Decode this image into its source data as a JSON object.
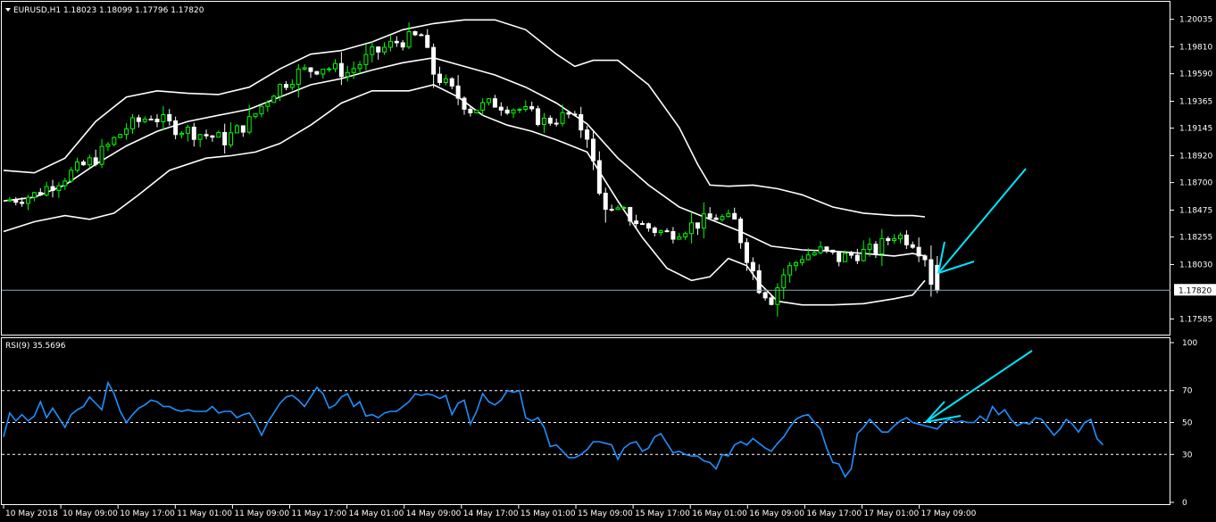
{
  "window": {
    "header_text": "EURUSD,H1  1.18023 1.18099 1.17796 1.17820",
    "indicator_text": "RSI(9) 35.5696"
  },
  "colors": {
    "background": "#000000",
    "bull_candle": "#00ff00",
    "bear_candle": "#ffffff",
    "bands": "#ffffff",
    "rsi_line": "#1e90ff",
    "arrow": "#00e5ff",
    "price_line": "#8aa8b8",
    "grid_dashed": "#ffffff"
  },
  "chart_data": [
    {
      "type": "candlestick",
      "title": "EURUSD,H1  1.18023 1.18099 1.17796 1.17820",
      "symbol": "EURUSD",
      "timeframe": "H1",
      "last_bar": {
        "open": 1.18023,
        "high": 1.18099,
        "low": 1.17796,
        "close": 1.1782
      },
      "current_price": 1.1782,
      "current_price_label": "1.17820",
      "y_ticks": [
        "1.20035",
        "1.19810",
        "1.19590",
        "1.19365",
        "1.19145",
        "1.18920",
        "1.18700",
        "1.18475",
        "1.18255",
        "1.18030",
        "1.17585"
      ],
      "ylim": [
        1.1753,
        1.2012
      ],
      "x_tick_labels": [
        "10 May 2018",
        "10 May 09:00",
        "10 May 17:00",
        "11 May 01:00",
        "11 May 09:00",
        "11 May 17:00",
        "14 May 01:00",
        "14 May 09:00",
        "14 May 17:00",
        "15 May 01:00",
        "15 May 09:00",
        "15 May 17:00",
        "16 May 01:00",
        "16 May 09:00",
        "16 May 17:00",
        "17 May 01:00",
        "17 May 09:00"
      ],
      "indicator": "Bollinger Bands",
      "close_path": [
        [
          0,
          1.1855
        ],
        [
          5,
          1.186
        ],
        [
          10,
          1.1875
        ],
        [
          15,
          1.189
        ],
        [
          20,
          1.1915
        ],
        [
          24,
          1.1925
        ],
        [
          28,
          1.1915
        ],
        [
          32,
          1.191
        ],
        [
          36,
          1.1905
        ],
        [
          40,
          1.192
        ],
        [
          44,
          1.1945
        ],
        [
          48,
          1.196
        ],
        [
          52,
          1.1965
        ],
        [
          56,
          1.196
        ],
        [
          60,
          1.1975
        ],
        [
          64,
          1.1985
        ],
        [
          68,
          1.199
        ],
        [
          70,
          1.196
        ],
        [
          72,
          1.195
        ],
        [
          76,
          1.193
        ],
        [
          80,
          1.1935
        ],
        [
          84,
          1.193
        ],
        [
          88,
          1.192
        ],
        [
          92,
          1.1925
        ],
        [
          95,
          1.191
        ],
        [
          97,
          1.186
        ],
        [
          99,
          1.1845
        ],
        [
          101,
          1.1845
        ],
        [
          104,
          1.1835
        ],
        [
          108,
          1.1828
        ],
        [
          112,
          1.1835
        ],
        [
          116,
          1.1842
        ],
        [
          119,
          1.1838
        ],
        [
          121,
          1.181
        ],
        [
          123,
          1.1785
        ],
        [
          125,
          1.1775
        ],
        [
          127,
          1.1795
        ],
        [
          130,
          1.181
        ],
        [
          133,
          1.1814
        ],
        [
          136,
          1.1808
        ],
        [
          139,
          1.1812
        ],
        [
          142,
          1.1815
        ],
        [
          145,
          1.1828
        ],
        [
          148,
          1.1822
        ],
        [
          150,
          1.181
        ],
        [
          151,
          1.179
        ],
        [
          152,
          1.1782
        ]
      ],
      "bands_upper": [
        [
          0,
          1.188
        ],
        [
          5,
          1.1878
        ],
        [
          10,
          1.189
        ],
        [
          15,
          1.192
        ],
        [
          20,
          1.194
        ],
        [
          25,
          1.1945
        ],
        [
          30,
          1.1943
        ],
        [
          35,
          1.1942
        ],
        [
          40,
          1.1948
        ],
        [
          45,
          1.1963
        ],
        [
          50,
          1.1975
        ],
        [
          55,
          1.1978
        ],
        [
          60,
          1.1985
        ],
        [
          65,
          1.1995
        ],
        [
          70,
          1.2
        ],
        [
          75,
          1.2003
        ],
        [
          80,
          1.2003
        ],
        [
          85,
          1.1995
        ],
        [
          90,
          1.1975
        ],
        [
          93,
          1.1965
        ],
        [
          96,
          1.197
        ],
        [
          100,
          1.197
        ],
        [
          105,
          1.195
        ],
        [
          110,
          1.1915
        ],
        [
          113,
          1.1885
        ],
        [
          115,
          1.1868
        ],
        [
          118,
          1.1867
        ],
        [
          122,
          1.1868
        ],
        [
          126,
          1.1865
        ],
        [
          130,
          1.186
        ],
        [
          135,
          1.185
        ],
        [
          140,
          1.1845
        ],
        [
          145,
          1.1843
        ],
        [
          148,
          1.1843
        ],
        [
          150,
          1.1842
        ]
      ],
      "bands_middle": [
        [
          0,
          1.1855
        ],
        [
          5,
          1.1858
        ],
        [
          10,
          1.1868
        ],
        [
          15,
          1.1885
        ],
        [
          20,
          1.19
        ],
        [
          25,
          1.1912
        ],
        [
          30,
          1.192
        ],
        [
          35,
          1.1925
        ],
        [
          40,
          1.193
        ],
        [
          45,
          1.194
        ],
        [
          50,
          1.195
        ],
        [
          55,
          1.1955
        ],
        [
          60,
          1.1962
        ],
        [
          65,
          1.1968
        ],
        [
          70,
          1.1972
        ],
        [
          75,
          1.1965
        ],
        [
          80,
          1.1958
        ],
        [
          85,
          1.1948
        ],
        [
          90,
          1.1935
        ],
        [
          95,
          1.1918
        ],
        [
          100,
          1.189
        ],
        [
          105,
          1.1868
        ],
        [
          110,
          1.185
        ],
        [
          115,
          1.184
        ],
        [
          120,
          1.183
        ],
        [
          125,
          1.1818
        ],
        [
          130,
          1.1815
        ],
        [
          135,
          1.1814
        ],
        [
          140,
          1.1812
        ],
        [
          145,
          1.181
        ],
        [
          148,
          1.1812
        ],
        [
          150,
          1.181
        ]
      ],
      "bands_lower": [
        [
          0,
          1.183
        ],
        [
          5,
          1.1838
        ],
        [
          10,
          1.1843
        ],
        [
          14,
          1.184
        ],
        [
          18,
          1.1845
        ],
        [
          22,
          1.186
        ],
        [
          27,
          1.188
        ],
        [
          33,
          1.189
        ],
        [
          37,
          1.1892
        ],
        [
          41,
          1.1895
        ],
        [
          45,
          1.1902
        ],
        [
          50,
          1.1917
        ],
        [
          55,
          1.1935
        ],
        [
          60,
          1.1945
        ],
        [
          66,
          1.1945
        ],
        [
          70,
          1.195
        ],
        [
          74,
          1.194
        ],
        [
          78,
          1.1925
        ],
        [
          82,
          1.1917
        ],
        [
          86,
          1.1912
        ],
        [
          90,
          1.1905
        ],
        [
          95,
          1.1895
        ],
        [
          100,
          1.1855
        ],
        [
          104,
          1.1825
        ],
        [
          108,
          1.18
        ],
        [
          112,
          1.179
        ],
        [
          115,
          1.1793
        ],
        [
          118,
          1.1808
        ],
        [
          121,
          1.1802
        ],
        [
          123,
          1.1788
        ],
        [
          126,
          1.1773
        ],
        [
          130,
          1.177
        ],
        [
          135,
          1.177
        ],
        [
          140,
          1.1771
        ],
        [
          145,
          1.1775
        ],
        [
          148,
          1.1778
        ],
        [
          150,
          1.179
        ]
      ]
    },
    {
      "type": "line",
      "title": "RSI(9) 35.5696",
      "ylim": [
        0,
        100
      ],
      "y_ticks": [
        0,
        30,
        50,
        70,
        100
      ],
      "levels": [
        30,
        50,
        70
      ],
      "current_value": 35.5696,
      "values": [
        41,
        56,
        51,
        55,
        51,
        54,
        63,
        53,
        59,
        53,
        47,
        55,
        58,
        60,
        66,
        62,
        58,
        75,
        68,
        57,
        50,
        55,
        59,
        61,
        64,
        63,
        60,
        60,
        58,
        57,
        58,
        57,
        57,
        57,
        60,
        56,
        57,
        57,
        53,
        55,
        56,
        50,
        42,
        50,
        56,
        62,
        66,
        67,
        64,
        60,
        66,
        72,
        68,
        59,
        61,
        66,
        68,
        60,
        63,
        54,
        55,
        53,
        56,
        57,
        57,
        60,
        63,
        68,
        67,
        68,
        67,
        65,
        67,
        55,
        62,
        64,
        49,
        57,
        68,
        63,
        61,
        64,
        70,
        69,
        70,
        53,
        51,
        53,
        47,
        35,
        36,
        32,
        28,
        28,
        30,
        33,
        38,
        38,
        37,
        36,
        27,
        34,
        37,
        38,
        32,
        34,
        41,
        43,
        37,
        31,
        32,
        30,
        29,
        29,
        26,
        25,
        21,
        30,
        29,
        36,
        38,
        36,
        40,
        37,
        34,
        32,
        37,
        41,
        47,
        52,
        54,
        55,
        50,
        46,
        34,
        25,
        24,
        16,
        21,
        43,
        47,
        52,
        48,
        44,
        44,
        48,
        51,
        53,
        50,
        49,
        48,
        47,
        46,
        50,
        52,
        50,
        51,
        50,
        50,
        54,
        51,
        60,
        55,
        58,
        52,
        48,
        50,
        49,
        53,
        52,
        47,
        42,
        46,
        52,
        49,
        44,
        50,
        52,
        40,
        36
      ]
    }
  ]
}
